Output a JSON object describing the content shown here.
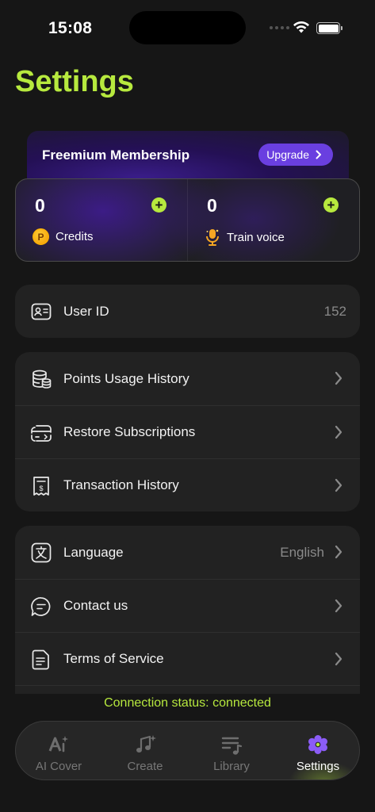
{
  "status_bar": {
    "time": "15:08"
  },
  "header": {
    "title": "Settings"
  },
  "membership": {
    "label": "Freemium Membership",
    "upgrade_label": "Upgrade"
  },
  "balances": {
    "credits": {
      "value": "0",
      "label": "Credits",
      "icon": "coin-icon"
    },
    "train_voice": {
      "value": "0",
      "label": "Train voice",
      "icon": "microphone-icon"
    }
  },
  "account": {
    "user_id_label": "User ID",
    "user_id_value": "152"
  },
  "history": {
    "items": [
      {
        "label": "Points Usage History",
        "icon": "database-icon"
      },
      {
        "label": "Restore Subscriptions",
        "icon": "restore-card-icon"
      },
      {
        "label": "Transaction History",
        "icon": "receipt-icon"
      }
    ]
  },
  "general": {
    "items": [
      {
        "label": "Language",
        "value": "English",
        "icon": "translate-icon"
      },
      {
        "label": "Contact us",
        "icon": "chat-icon"
      },
      {
        "label": "Terms of Service",
        "icon": "document-icon"
      }
    ]
  },
  "connection": {
    "status_text": "Connection status: connected"
  },
  "tabbar": {
    "tabs": [
      {
        "label": "AI Cover",
        "icon": "ai-icon",
        "active": false
      },
      {
        "label": "Create",
        "icon": "music-note-icon",
        "active": false
      },
      {
        "label": "Library",
        "icon": "playlist-icon",
        "active": false
      },
      {
        "label": "Settings",
        "icon": "gear-icon",
        "active": true
      }
    ]
  },
  "colors": {
    "accent": "#b7e93e",
    "brand_purple": "#6a3fe0",
    "background": "#161616",
    "card": "#222222"
  }
}
